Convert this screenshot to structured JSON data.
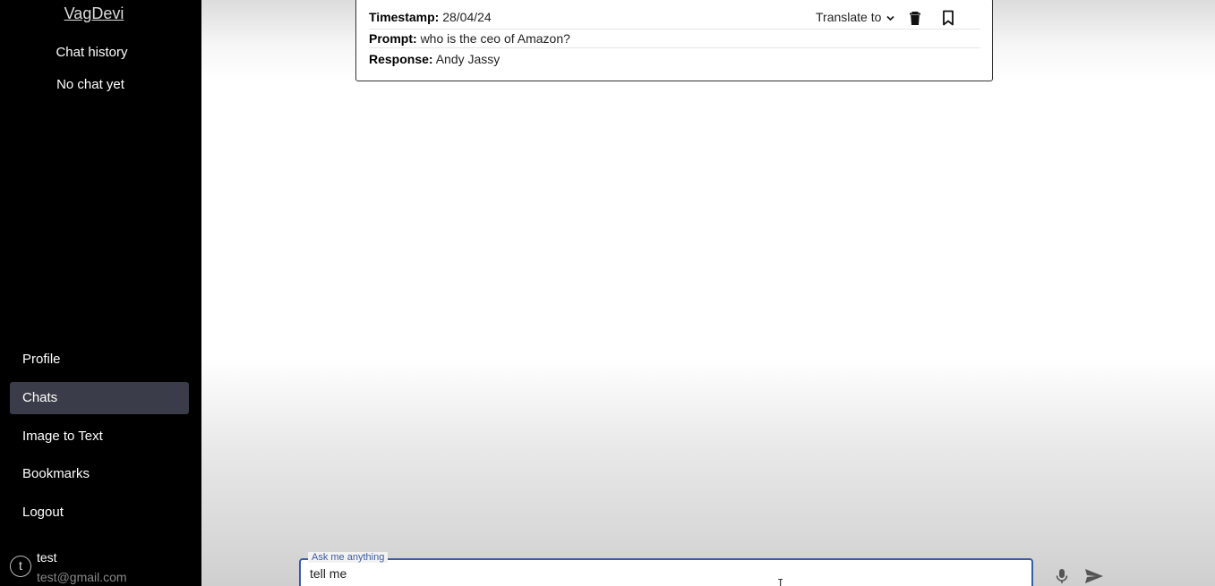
{
  "app": {
    "brand": "VagDevi"
  },
  "sidebar": {
    "history_title": "Chat history",
    "history_empty": "No chat yet",
    "nav": [
      {
        "label": "Profile",
        "active": false
      },
      {
        "label": "Chats",
        "active": true
      },
      {
        "label": "Image to Text",
        "active": false
      },
      {
        "label": "Bookmarks",
        "active": false
      },
      {
        "label": "Logout",
        "active": false
      }
    ],
    "user": {
      "initial": "t",
      "name": "test",
      "email": "test@gmail.com"
    }
  },
  "chat_card": {
    "timestamp_label": "Timestamp:",
    "timestamp_value": "28/04/24",
    "prompt_label": "Prompt:",
    "prompt_value": "who is the ceo of Amazon?",
    "response_label": "Response:",
    "response_value": "Andy Jassy",
    "translate_label": "Translate to",
    "icons": [
      "chevron-down-icon",
      "trash-icon",
      "bookmark-icon"
    ]
  },
  "composer": {
    "label": "Ask me anything",
    "value": "tell me",
    "icons": [
      "microphone-icon",
      "send-icon"
    ]
  },
  "colors": {
    "sidebar_bg": "#000000",
    "active_nav_bg": "#3a3d49",
    "input_accent": "#3b5ba5"
  }
}
